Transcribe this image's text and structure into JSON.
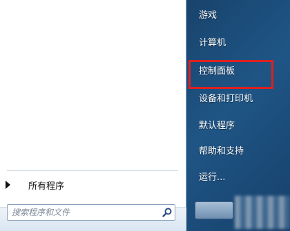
{
  "start_menu": {
    "all_programs_label": "所有程序",
    "search": {
      "placeholder": "搜索程序和文件",
      "value": ""
    },
    "right_items": [
      {
        "label": "游戏"
      },
      {
        "label": "计算机"
      },
      {
        "label": "控制面板"
      },
      {
        "label": "设备和打印机"
      },
      {
        "label": "默认程序"
      },
      {
        "label": "帮助和支持"
      },
      {
        "label": "运行..."
      }
    ],
    "highlighted_item": "控制面板",
    "colors": {
      "right_panel": "#1f5585",
      "highlight_border": "#e02020",
      "left_panel": "#ffffff"
    },
    "icons": [
      "arrow-right-icon",
      "search-icon"
    ]
  }
}
